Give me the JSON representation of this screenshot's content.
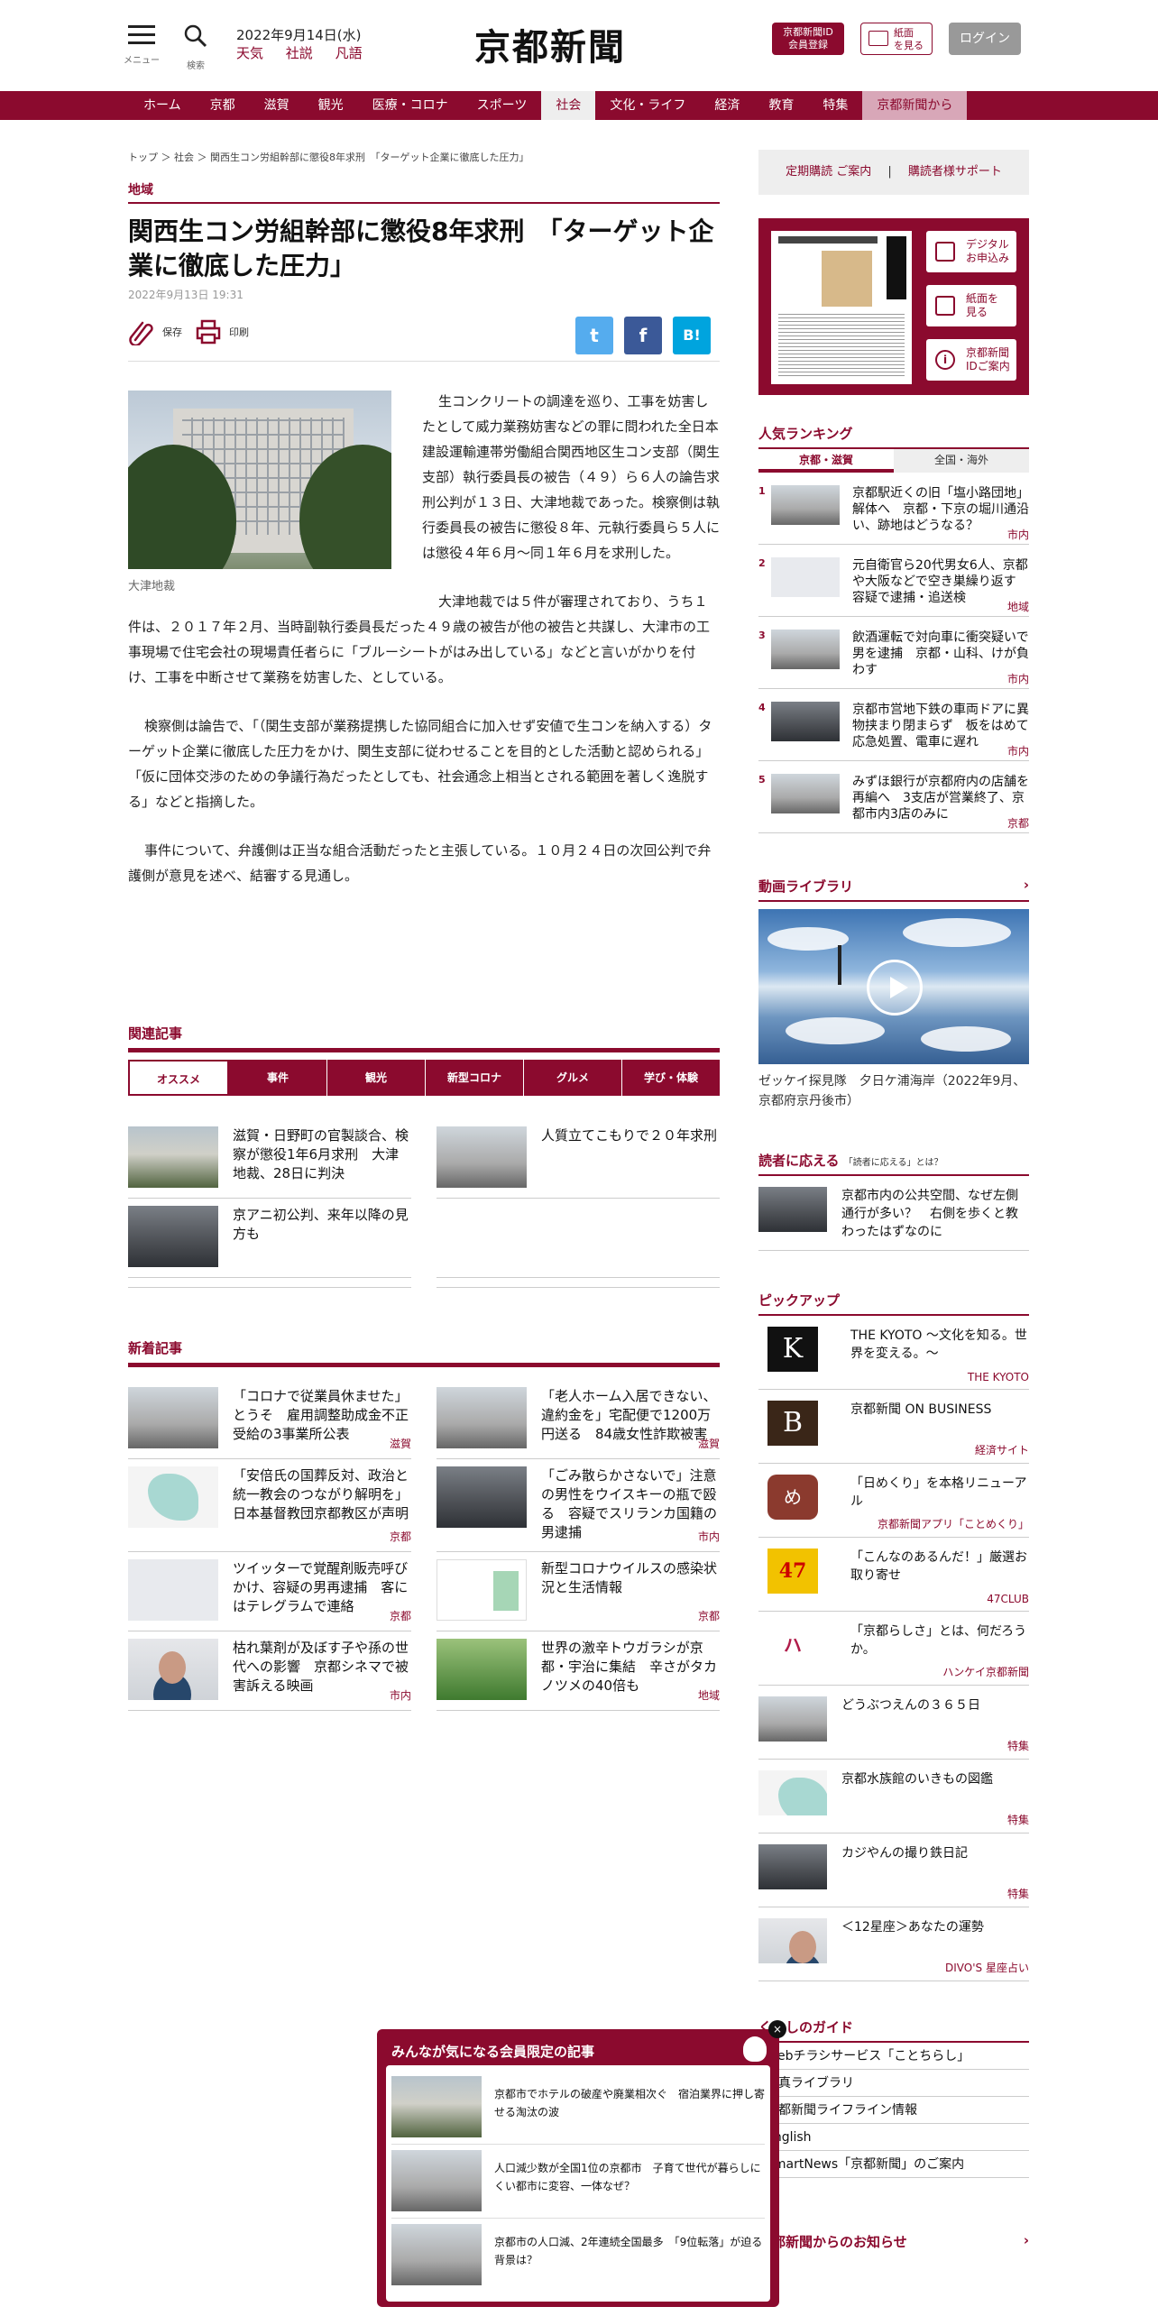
{
  "header": {
    "menu_label": "メニュー",
    "search_label": "検索",
    "date": "2022年9月14日(水)",
    "links": [
      "天気",
      "社説",
      "凡語"
    ],
    "logo": "京都新聞",
    "id_button": [
      "京都新聞ID",
      "会員登録"
    ],
    "paper_button": [
      "紙面",
      "を見る"
    ],
    "login_button": "ログイン"
  },
  "nav": {
    "items": [
      "ホーム",
      "京都",
      "滋賀",
      "観光",
      "医療・コロナ",
      "スポーツ",
      "社会",
      "文化・ライフ",
      "経済",
      "教育",
      "特集",
      "京都新聞から"
    ],
    "active": "社会"
  },
  "article": {
    "breadcrumb": "トップ ＞ 社会 ＞ 関西生コン労組幹部に懲役8年求刑　「ターゲット企業に徹底した圧力」",
    "category": "地域",
    "title": "関西生コン労組幹部に懲役8年求刑　「ターゲット企業に徹底した圧力」",
    "date": "2022年9月13日 19:31",
    "save_label": "保存",
    "print_label": "印刷",
    "share": {
      "twitter": "t",
      "facebook": "f",
      "hatena": "B!"
    },
    "photo_caption": "大津地裁",
    "paragraphs": [
      "生コンクリートの調達を巡り、工事を妨害したとして威力業務妨害などの罪に問われた全日本建設運輸連帯労働組合関西地区生コン支部（関生支部）執行委員長の被告（４９）ら６人の論告求刑公判が１３日、大津地裁であった。検察側は執行委員長の被告に懲役８年、元執行委員ら５人には懲役４年６月～同１年６月を求刑した。",
      "大津地裁では５件が審理されており、うち１件は、２０１７年２月、当時副執行委員長だった４９歳の被告が他の被告と共謀し、大津市の工事現場で住宅会社の現場責任者らに「ブルーシートがはみ出している」などと言いがかりを付け、工事を中断させて業務を妨害した、としている。",
      "検察側は論告で、「（関生支部が業務提携した協同組合に加入せず安値で生コンを納入する）ターゲット企業に徹底した圧力をかけ、関生支部に従わせることを目的とした活動と認められる」「仮に団体交渉のための争議行為だったとしても、社会通念上相当とされる範囲を著しく逸脱する」などと指摘した。",
      "事件について、弁護側は正当な組合活動だったと主張している。１０月２４日の次回公判で弁護側が意見を述べ、結審する見通し。"
    ]
  },
  "related": {
    "title": "関連記事",
    "tabs": [
      "オススメ",
      "事件",
      "観光",
      "新型コロナ",
      "グルメ",
      "学び・体験"
    ],
    "items": [
      {
        "title": "滋賀・日野町の官製談合、検察が懲役1年6月求刑　大津地裁、28日に判決",
        "thumb": "th-court"
      },
      {
        "title": "人質立てこもりで２０年求刑",
        "thumb": "th-bldg"
      },
      {
        "title": "京アニ初公判、来年以降の見方も",
        "thumb": "th-street"
      }
    ]
  },
  "latest": {
    "title": "新着記事",
    "items": [
      {
        "title": "「コロナで従業員休ませた」とうそ　雇用調整助成金不正受給の3事業所公表",
        "area": "滋賀",
        "thumb": "th-bldg"
      },
      {
        "title": "「老人ホーム入居できない、違約金を」宅配便で1200万円送る　84歳女性詐欺被害",
        "area": "滋賀",
        "thumb": "th-bldg"
      },
      {
        "title": "「安倍氏の国葬反対、政治と統一教会のつながり解明を」　日本基督教団京都教区が声明",
        "area": "京都",
        "thumb": "th-map"
      },
      {
        "title": "「ごみ散らかさないで」注意の男性をウイスキーの瓶で殴る　容疑でスリランカ国籍の男逮捕",
        "area": "市内",
        "thumb": "th-street"
      },
      {
        "title": "ツイッターで覚醒剤販売呼びかけ、容疑の男再逮捕　客にはテレグラムで連絡",
        "area": "京都",
        "thumb": "th-doc"
      },
      {
        "title": "新型コロナウイルスの感染状況と生活情報",
        "area": "京都",
        "thumb": "th-chart"
      },
      {
        "title": "枯れ葉剤が及ぼす子や孫の世代への影響　京都シネマで被害訴える映画",
        "area": "市内",
        "thumb": "th-person"
      },
      {
        "title": "世界の激辛トウガラシが京都・宇治に集結　辛さがタカノツメの40倍も",
        "area": "地域",
        "thumb": "th-flower"
      }
    ]
  },
  "sidebar": {
    "subscribe_links": [
      "定期購読 ご案内",
      "購読者様サポート"
    ],
    "paper_buttons": [
      [
        "デジタル",
        "お申込み"
      ],
      [
        "紙面を",
        "見る"
      ],
      [
        "京都新聞",
        "IDご案内"
      ]
    ],
    "ranking": {
      "title": "人気ランキング",
      "tabs": [
        "京都・滋賀",
        "全国・海外"
      ],
      "items": [
        {
          "num": "1",
          "title": "京都駅近くの旧「塩小路団地」解体へ　京都・下京の堀川通沿い、跡地はどうなる？",
          "area": "市内",
          "thumb": "th-bldg"
        },
        {
          "num": "2",
          "title": "元自衛官ら20代男女6人、京都や大阪などで空き巣繰り返す　容疑で逮捕・追送検",
          "area": "地域",
          "thumb": "th-doc"
        },
        {
          "num": "3",
          "title": "飲酒運転で対向車に衝突疑いで男を逮捕　京都・山科、けが負わす",
          "area": "市内",
          "thumb": "th-bldg"
        },
        {
          "num": "4",
          "title": "京都市営地下鉄の車両ドアに異物挟まり閉まらず　板をはめて応急処置、電車に遅れ",
          "area": "市内",
          "thumb": "th-street"
        },
        {
          "num": "5",
          "title": "みずほ銀行が京都府内の店舗を再編へ　3支店が営業終了、京都市内3店のみに",
          "area": "京都",
          "thumb": "th-bldg"
        }
      ]
    },
    "video": {
      "title": "動画ライブラリ",
      "caption": "ゼッケイ探見隊　夕日ケ浦海岸（2022年9月、京都府京丹後市）"
    },
    "reader": {
      "title": "読者に応える",
      "sub": "「読者に応える」とは？",
      "item": "京都市内の公共空間、なぜ左側通行が多い？　右側を歩くと教わったはずなのに"
    },
    "pickup": {
      "title": "ピックアップ",
      "items": [
        {
          "title": "THE KYOTO ～文化を知る。世界を変える。～",
          "src": "THE KYOTO",
          "logo": "K",
          "color": "#111111"
        },
        {
          "title": "京都新聞 ON BUSINESS",
          "src": "経済サイト",
          "logo": "B",
          "color": "#3a2618"
        },
        {
          "title": "「日めくり」を本格リニューアル",
          "src": "京都新聞アプリ「ことめくり」",
          "logo": "め",
          "color": "#8b3a2e"
        },
        {
          "title": "「こんなのあるんだ！」厳選お取り寄せ",
          "src": "47CLUB",
          "logo": "47",
          "color": "#f2c200"
        },
        {
          "title": "「京都らしさ」とは、何だろうか。",
          "src": "ハンケイ京都新聞",
          "logo": "ハ",
          "color": "#b01c4a"
        },
        {
          "title": "どうぶつえんの３６５日",
          "src": "特集",
          "thumb": "th-bldg"
        },
        {
          "title": "京都水族館のいきもの図鑑",
          "src": "特集",
          "thumb": "th-map"
        },
        {
          "title": "カジやんの撮り鉄日記",
          "src": "特集",
          "thumb": "th-street"
        },
        {
          "title": "＜12星座＞あなたの運勢",
          "src": "DIVO'S 星座占い",
          "thumb": "th-person"
        }
      ]
    },
    "guide": {
      "title": "くらしのガイド",
      "items": [
        "Webチラシサービス「ことちらし」",
        "写真ライブラリ",
        "京都新聞ライフライン情報",
        "English",
        "SmartNews「京都新聞」のご案内"
      ]
    },
    "notice_title": "京都新聞からのお知らせ"
  },
  "popup": {
    "title": "みんなが気になる会員限定の記事",
    "close": "×",
    "items": [
      {
        "title": "京都市でホテルの破産や廃業相次ぐ　宿泊業界に押し寄せる淘汰の波",
        "thumb": "th-court"
      },
      {
        "title": "人口減少数が全国1位の京都市　子育て世代が暮らしにくい都市に変容、一体なぜ？",
        "thumb": "th-bldg"
      },
      {
        "title": "京都市の人口減、2年連続全国最多　「9位転落」が迫る背景は？",
        "thumb": "th-bldg"
      }
    ]
  },
  "colors": {
    "brand": "#8b0a2e",
    "twitter": "#55acee",
    "facebook": "#3b5998",
    "hatena": "#00a4de"
  }
}
